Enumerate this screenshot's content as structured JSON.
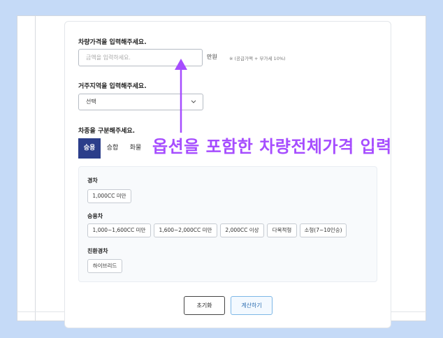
{
  "form": {
    "price_label": "차량가격을 입력해주세요.",
    "price_placeholder": "금액을 입력하세요.",
    "price_unit": "만원",
    "price_note": "※ (공급가액 + 부가세 10%)",
    "region_label": "거주지역을 입력해주세요.",
    "region_value": "선택",
    "type_label": "차종을 구분해주세요."
  },
  "tabs": [
    {
      "label": "승용",
      "active": true
    },
    {
      "label": "승합",
      "active": false
    },
    {
      "label": "화물",
      "active": false
    }
  ],
  "groups": [
    {
      "title": "경차",
      "options": [
        "1,000CC 미만"
      ]
    },
    {
      "title": "승용차",
      "options": [
        "1,000~1,600CC 미만",
        "1,600~2,000CC 미만",
        "2,000CC 이상",
        "다목적형",
        "소형(7~10인승)"
      ]
    },
    {
      "title": "친환경차",
      "options": [
        "하이브리드"
      ]
    }
  ],
  "buttons": {
    "reset": "초기화",
    "calculate": "계산하기"
  },
  "annotation": {
    "text": "옵션을 포함한 차량전체가격 입력",
    "color": "#a64dff"
  },
  "icons": {
    "dropdown": "chevron-down-icon",
    "annotation_arrow": "arrow-up-icon"
  }
}
